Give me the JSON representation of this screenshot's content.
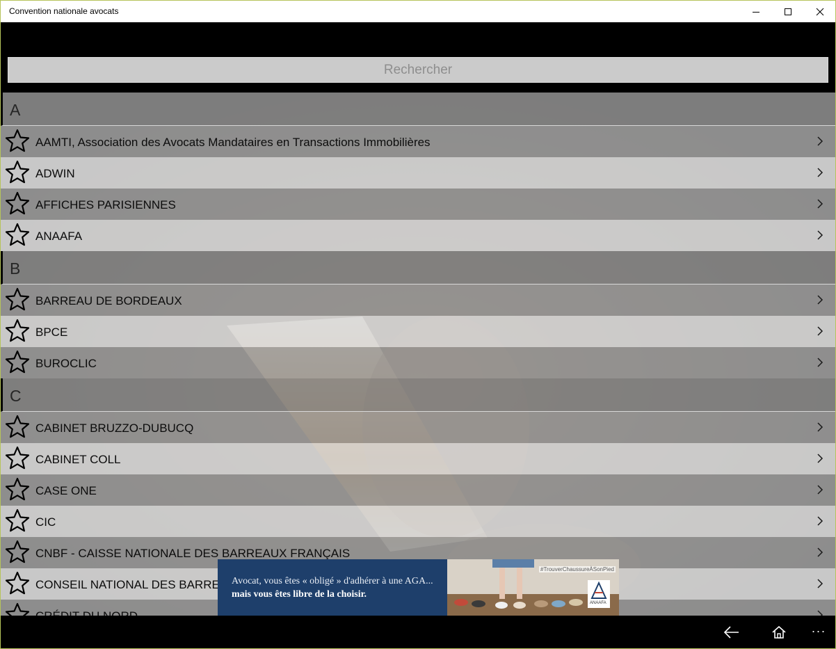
{
  "window": {
    "title": "Convention nationale avocats"
  },
  "search": {
    "placeholder": "Rechercher",
    "value": ""
  },
  "groups": [
    {
      "letter": "A",
      "items": [
        "AAMTI, Association des Avocats Mandataires en Transactions Immobilières",
        "ADWIN",
        "AFFICHES PARISIENNES",
        "ANAAFA"
      ]
    },
    {
      "letter": "B",
      "items": [
        "BARREAU DE BORDEAUX",
        "BPCE",
        "BUROCLIC"
      ]
    },
    {
      "letter": "C",
      "items": [
        "CABINET BRUZZO-DUBUCQ",
        "CABINET COLL",
        "CASE ONE",
        "CIC",
        "CNBF - CAISSE NATIONALE DES BARREAUX FRANÇAIS",
        "CONSEIL NATIONAL DES BARREAUX",
        "CRÉDIT DU NORD"
      ]
    }
  ],
  "ad": {
    "line1": "Avocat, vous êtes « obligé » d'adhérer à une AGA...",
    "line2": "mais vous êtes libre de la choisir.",
    "hashtag": "#TrouverChaussureÀSonPied",
    "logo_text": "ANAAFA"
  },
  "bottombar": {
    "back_icon": "arrow-left-icon",
    "home_icon": "home-icon",
    "more_label": "···"
  },
  "colors": {
    "titlebar": "#ffffff",
    "chrome": "#000000",
    "search_bg": "#cbcbcb",
    "ad_bg": "#1e3f6b"
  }
}
